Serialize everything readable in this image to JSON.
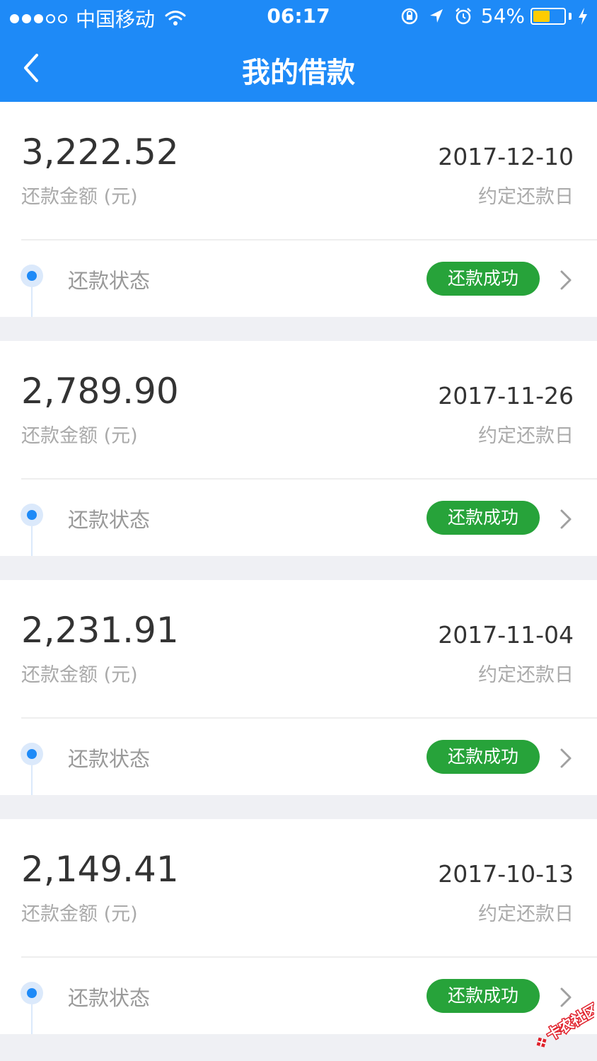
{
  "status_bar": {
    "carrier": "中国移动",
    "time": "06:17",
    "battery_percent": "54%",
    "battery_level": 0.54,
    "signal_bars_filled": 3,
    "signal_bars_total": 5
  },
  "header": {
    "title": "我的借款",
    "back_icon": "chevron-left-icon",
    "background_color": "#1e8af7"
  },
  "loans": [
    {
      "amount": "3,222.52",
      "amount_label": "还款金额 (元)",
      "date": "2017-12-10",
      "date_label": "约定还款日",
      "status_label": "还款状态",
      "status_value": "还款成功"
    },
    {
      "amount": "2,789.90",
      "amount_label": "还款金额 (元)",
      "date": "2017-11-26",
      "date_label": "约定还款日",
      "status_label": "还款状态",
      "status_value": "还款成功"
    },
    {
      "amount": "2,231.91",
      "amount_label": "还款金额 (元)",
      "date": "2017-11-04",
      "date_label": "约定还款日",
      "status_label": "还款状态",
      "status_value": "还款成功"
    },
    {
      "amount": "2,149.41",
      "amount_label": "还款金额 (元)",
      "date": "2017-10-13",
      "date_label": "约定还款日",
      "status_label": "还款状态",
      "status_value": "还款成功"
    }
  ],
  "colors": {
    "accent": "#1e8af7",
    "success": "#27a33a",
    "watermark": "#e0202a"
  },
  "watermark": {
    "text": "卡农社区"
  }
}
